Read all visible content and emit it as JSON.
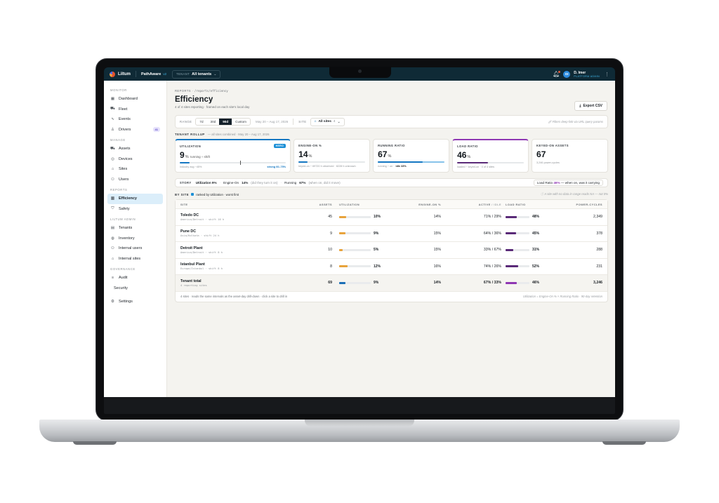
{
  "topbar": {
    "brand": "Liltum",
    "product": "PathAware",
    "product_version": "v2",
    "tenant_label": "TENANT",
    "tenant_value": "All tenants",
    "avatar_initials": "DI",
    "user_name": "D. Imer",
    "user_role": "PLATFORM ADMIN"
  },
  "sidebar": {
    "sections": [
      {
        "title": "MONITOR",
        "items": [
          {
            "label": "Dashboard",
            "icon": "grid-icon",
            "glyph": "▦"
          },
          {
            "label": "Fleet",
            "icon": "truck-icon",
            "glyph": "⛟"
          },
          {
            "label": "Events",
            "icon": "pulse-icon",
            "glyph": "∿"
          },
          {
            "label": "Drivers",
            "icon": "user-icon",
            "glyph": "♙",
            "badge": "41"
          }
        ]
      },
      {
        "title": "MANAGE",
        "items": [
          {
            "label": "Assets",
            "icon": "truck-icon",
            "glyph": "⛟"
          },
          {
            "label": "Devices",
            "icon": "device-icon",
            "glyph": "◎"
          },
          {
            "label": "Sites",
            "icon": "building-icon",
            "glyph": "⌂"
          },
          {
            "label": "Users",
            "icon": "users-icon",
            "glyph": "⚇"
          }
        ]
      },
      {
        "title": "REPORTS",
        "items": [
          {
            "label": "Efficiency",
            "icon": "bar-chart-icon",
            "glyph": "▥",
            "active": true
          },
          {
            "label": "Safety",
            "icon": "shield-icon",
            "glyph": "⛉"
          }
        ]
      },
      {
        "title": "LILTUM ADMIN",
        "items": [
          {
            "label": "Tenants",
            "icon": "tenant-icon",
            "glyph": "▤"
          },
          {
            "label": "Inventory",
            "icon": "box-icon",
            "glyph": "◍"
          },
          {
            "label": "Internal users",
            "icon": "users-icon",
            "glyph": "⚇"
          },
          {
            "label": "Internal sites",
            "icon": "building-icon",
            "glyph": "⌂"
          }
        ]
      },
      {
        "title": "GOVERNANCE",
        "items": [
          {
            "label": "Audit",
            "icon": "list-icon",
            "glyph": "≡"
          },
          {
            "label": "Security",
            "icon": "",
            "glyph": ""
          }
        ]
      },
      {
        "title": "",
        "items": [
          {
            "label": "Settings",
            "icon": "gear-icon",
            "glyph": "⚙"
          }
        ]
      }
    ]
  },
  "header": {
    "crumb_a": "REPORTS",
    "crumb_b": "/reports/efficiency",
    "title": "Efficiency",
    "subtitle": "4 of 4 sites reporting · framed on each site's local day",
    "export_label": "Export CSV"
  },
  "filters": {
    "range_label": "RANGE",
    "ranges": [
      "7d",
      "30d",
      "90d",
      "Custom"
    ],
    "selected_range": "90d",
    "date_range": "May 20 – Aug 17, 2026",
    "site_label": "SITE",
    "site_value": "All sites",
    "site_count": "4",
    "hint": "Filters deep-link via URL query params"
  },
  "rollup": {
    "label": "TENANT ROLLUP",
    "sub": "— all sites combined · May 20 – Aug 17, 2026"
  },
  "cards": {
    "utilization": {
      "title": "UTILIZATION",
      "badge": "HERO",
      "value": "9",
      "unit": "%",
      "note": "running ÷ shift",
      "fill": 0.09,
      "marker": 0.57,
      "foot_left": "industry avg ~45%",
      "foot_right": "strong 60–75%"
    },
    "engine_on": {
      "title": "ENGINE-ON %",
      "value": "14",
      "unit": "%",
      "fill": 0.14,
      "foot": "keyed-on ÷ 69720 h observed · 8228 h unknown"
    },
    "running": {
      "title": "RUNNING RATIO",
      "value": "67",
      "unit": "%",
      "fill": 0.67,
      "foot_a": "running ÷ on ·",
      "foot_b": "idle 33%"
    },
    "load": {
      "title": "LOAD RATIO",
      "value": "46",
      "unit": "%",
      "fill": 0.46,
      "foot": "loaded ÷ keyed-on · 4 of 4 sites"
    },
    "keyed": {
      "title": "KEYED-ON ASSETS",
      "value": "67",
      "foot": "3,246 power-cycles"
    }
  },
  "story": {
    "label": "STORY",
    "a1": "Utilization 9%",
    "a2": "·",
    "a3": "Engine-On",
    "a4": "14%",
    "a5": "(did they turn it on)",
    "b1": "·",
    "b2": "Running",
    "b3": "67%",
    "b4": "(when on, did it move)",
    "lr1": "Load Ratio",
    "lr2": "46%",
    "lr3": "— when on, was it carrying"
  },
  "bysite": {
    "label": "BY SITE",
    "ranked": "ranked by Utilization · worst first",
    "hint": "A site with no data in range reads NA — not 0%"
  },
  "table": {
    "headers": {
      "site": "SITE",
      "assets": "ASSETS",
      "util": "UTILIZATION",
      "eng": "ENGINE-ON %",
      "act1": "ACTIVE",
      "act2": "/ IDLE",
      "load": "LOAD RATIO",
      "pc": "POWER-CYCLES"
    },
    "rows": [
      {
        "name": "Toledo DC",
        "tz": "America/Detroit · shift 16 h",
        "assets": "45",
        "util": "10%",
        "util_v": 0.1,
        "eng": "14%",
        "active": "71% / 29%",
        "load": "48%",
        "load_v": 0.48,
        "pc": "2,349"
      },
      {
        "name": "Pune DC",
        "tz": "Asia/Kolkata · shift 24 h",
        "assets": "9",
        "util": "9%",
        "util_v": 0.09,
        "eng": "15%",
        "active": "64% / 36%",
        "load": "45%",
        "load_v": 0.45,
        "pc": "378"
      },
      {
        "name": "Detroit Plant",
        "tz": "America/Detroit · shift 8 h",
        "assets": "10",
        "util": "5%",
        "util_v": 0.05,
        "eng": "15%",
        "active": "33% / 67%",
        "load": "31%",
        "load_v": 0.31,
        "pc": "288"
      },
      {
        "name": "Istanbul Plant",
        "tz": "Europe/Istanbul · shift 8 h",
        "assets": "8",
        "util": "12%",
        "util_v": 0.12,
        "eng": "16%",
        "active": "74% / 26%",
        "load": "52%",
        "load_v": 0.52,
        "pc": "231"
      }
    ],
    "total": {
      "name": "Tenant total",
      "tz": "4 reporting sites",
      "assets": "69",
      "util": "9%",
      "util_v": 0.09,
      "eng": "14%",
      "active": "67% / 33%",
      "load": "46%",
      "load_v": 0.46,
      "pc": "3,246"
    },
    "foot_left": "4 sites · reads the same intervals as the asset-day drill-down · click a site to drill in",
    "foot_right": "Utilization = Engine-On % × Running Ratio · 90-day retention"
  },
  "colors": {
    "accent": "#1c8fd6",
    "util_bar": "#e8a33c",
    "load_bar": "#5a2a78",
    "util_total_bar": "#1c6fb6",
    "load_total_bar": "#8f37b3",
    "running_bar": "#1477c2",
    "running_bar_rest": "#87c3ea"
  }
}
